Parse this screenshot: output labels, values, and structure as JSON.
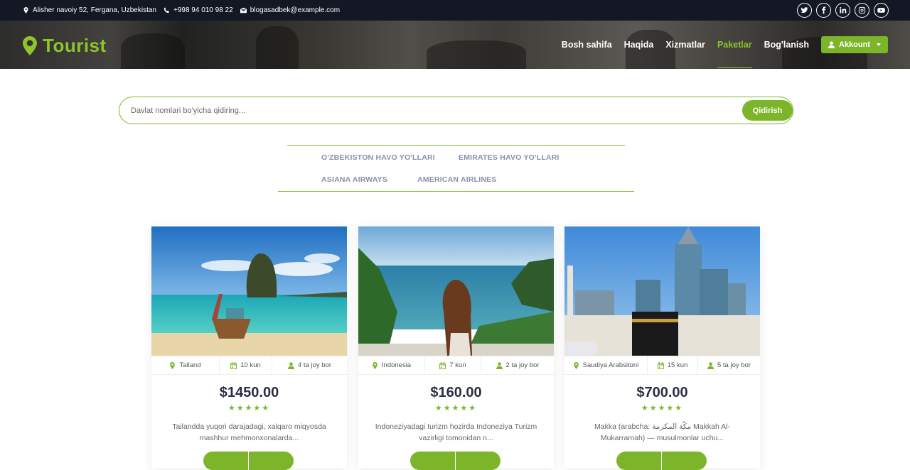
{
  "topbar": {
    "address": "Alisher navoiy 52, Fergana, Uzbekistan",
    "phone": "+998 94 010 98 22",
    "email": "blogasadbek@example.com",
    "social": [
      "twitter-icon",
      "facebook-icon",
      "linkedin-icon",
      "instagram-icon",
      "youtube-icon"
    ]
  },
  "brand": {
    "name": "Tourist",
    "color": "#8ec42c"
  },
  "nav": {
    "items": [
      "Bosh sahifa",
      "Haqida",
      "Xizmatlar",
      "Paketlar",
      "Bog'lanish"
    ],
    "active": "Paketlar",
    "account_label": "Akkount"
  },
  "search": {
    "placeholder": "Davlat nomlari bo'yicha qidiring...",
    "button": "Qidirish"
  },
  "filters": [
    "O'ZBEKISTON HAVO YO'LLARI",
    "EMIRATES HAVO YO'LLARI",
    "ASIANA AIRWAYS",
    "AMERICAN AIRLINES"
  ],
  "accent": "#7cb52a",
  "packages": [
    {
      "location": "Tailand",
      "duration": "10 kun",
      "seats": "4 ta joy bor",
      "price": "$1450.00",
      "rating": 5,
      "description": "Tailandda yuqori darajadagi, xalqaro miqyosda mashhur mehmonxonalarda..."
    },
    {
      "location": "Indonesia",
      "duration": "7 kun",
      "seats": "2 ta joy bor",
      "price": "$160.00",
      "rating": 5,
      "description": "Indoneziyadagi turizm hozirda Indoneziya Turizm vazirligi tomonidan n..."
    },
    {
      "location": "Saudiya Arabsitoni",
      "duration": "15 kun",
      "seats": "5 ta joy bor",
      "price": "$700.00",
      "rating": 5,
      "description": "Makka (arabcha: مكّة المكرمة Makkah Al-Mukarramah) — musulmonlar uchu..."
    }
  ]
}
